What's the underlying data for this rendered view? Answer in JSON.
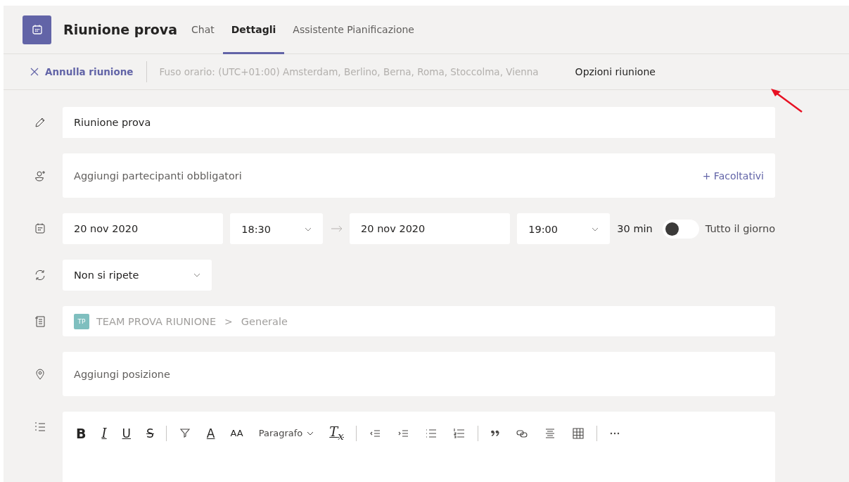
{
  "header": {
    "title": "Riunione prova",
    "tabs": [
      {
        "label": "Chat",
        "selected": false
      },
      {
        "label": "Dettagli",
        "selected": true
      },
      {
        "label": "Assistente Pianificazione",
        "selected": false
      }
    ]
  },
  "toolbar": {
    "cancel": "Annulla riunione",
    "timezone": "Fuso orario: (UTC+01:00) Amsterdam, Berlino, Berna, Roma, Stoccolma, Vienna",
    "options": "Opzioni riunione"
  },
  "form": {
    "title_value": "Riunione prova",
    "attendees_placeholder": "Aggiungi partecipanti obbligatori",
    "optional": "+ Facoltativi",
    "start_date": "20 nov 2020",
    "start_time": "18:30",
    "end_date": "20 nov 2020",
    "end_time": "19:00",
    "duration": "30 min",
    "all_day": {
      "label": "Tutto il giorno",
      "on": false
    },
    "repeat": "Non si ripete",
    "channel": {
      "badge": "TP",
      "team": "TEAM PROVA RIUNIONE",
      "separator": ">",
      "name": "Generale"
    },
    "location_placeholder": "Aggiungi posizione"
  },
  "editor": {
    "tools": [
      {
        "kind": "bold",
        "label": "B"
      },
      {
        "kind": "italic",
        "label": "I"
      },
      {
        "kind": "underline",
        "label": "U"
      },
      {
        "kind": "strike",
        "label": "S"
      },
      {
        "kind": "divider"
      },
      {
        "kind": "highlight"
      },
      {
        "kind": "fontcolor",
        "label": "A"
      },
      {
        "kind": "fontsize",
        "label": "AA"
      },
      {
        "kind": "paragraph",
        "label": "Paragrafo"
      },
      {
        "kind": "clear",
        "label": "T$_{x}$"
      },
      {
        "kind": "divider"
      },
      {
        "kind": "outdent"
      },
      {
        "kind": "indent"
      },
      {
        "kind": "bullets"
      },
      {
        "kind": "numbers"
      },
      {
        "kind": "divider"
      },
      {
        "kind": "quote"
      },
      {
        "kind": "link"
      },
      {
        "kind": "align"
      },
      {
        "kind": "table"
      },
      {
        "kind": "divider"
      },
      {
        "kind": "more"
      }
    ]
  }
}
